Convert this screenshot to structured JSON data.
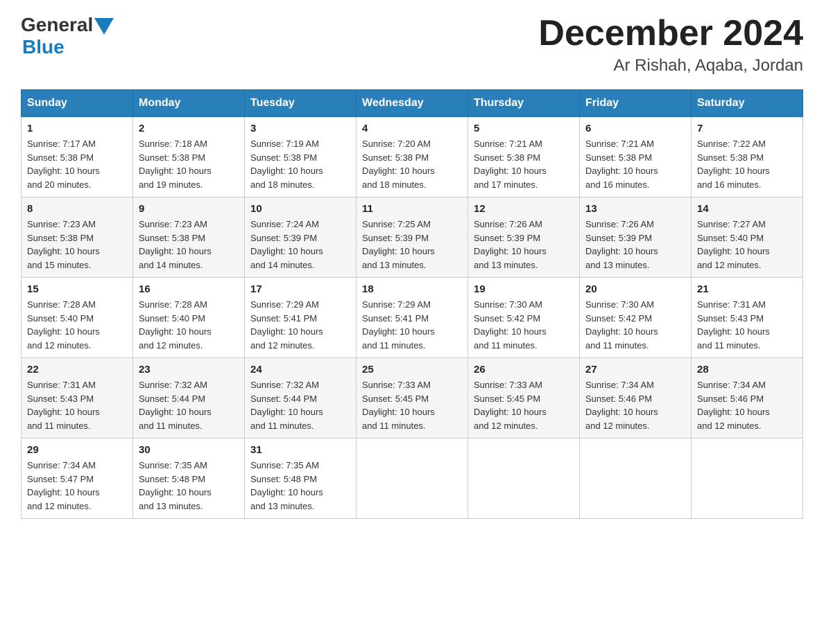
{
  "header": {
    "logo_general": "General",
    "logo_blue": "Blue",
    "month_title": "December 2024",
    "location": "Ar Rishah, Aqaba, Jordan"
  },
  "weekdays": [
    "Sunday",
    "Monday",
    "Tuesday",
    "Wednesday",
    "Thursday",
    "Friday",
    "Saturday"
  ],
  "weeks": [
    [
      {
        "day": "1",
        "sunrise": "7:17 AM",
        "sunset": "5:38 PM",
        "daylight": "10 hours and 20 minutes."
      },
      {
        "day": "2",
        "sunrise": "7:18 AM",
        "sunset": "5:38 PM",
        "daylight": "10 hours and 19 minutes."
      },
      {
        "day": "3",
        "sunrise": "7:19 AM",
        "sunset": "5:38 PM",
        "daylight": "10 hours and 18 minutes."
      },
      {
        "day": "4",
        "sunrise": "7:20 AM",
        "sunset": "5:38 PM",
        "daylight": "10 hours and 18 minutes."
      },
      {
        "day": "5",
        "sunrise": "7:21 AM",
        "sunset": "5:38 PM",
        "daylight": "10 hours and 17 minutes."
      },
      {
        "day": "6",
        "sunrise": "7:21 AM",
        "sunset": "5:38 PM",
        "daylight": "10 hours and 16 minutes."
      },
      {
        "day": "7",
        "sunrise": "7:22 AM",
        "sunset": "5:38 PM",
        "daylight": "10 hours and 16 minutes."
      }
    ],
    [
      {
        "day": "8",
        "sunrise": "7:23 AM",
        "sunset": "5:38 PM",
        "daylight": "10 hours and 15 minutes."
      },
      {
        "day": "9",
        "sunrise": "7:23 AM",
        "sunset": "5:38 PM",
        "daylight": "10 hours and 14 minutes."
      },
      {
        "day": "10",
        "sunrise": "7:24 AM",
        "sunset": "5:39 PM",
        "daylight": "10 hours and 14 minutes."
      },
      {
        "day": "11",
        "sunrise": "7:25 AM",
        "sunset": "5:39 PM",
        "daylight": "10 hours and 13 minutes."
      },
      {
        "day": "12",
        "sunrise": "7:26 AM",
        "sunset": "5:39 PM",
        "daylight": "10 hours and 13 minutes."
      },
      {
        "day": "13",
        "sunrise": "7:26 AM",
        "sunset": "5:39 PM",
        "daylight": "10 hours and 13 minutes."
      },
      {
        "day": "14",
        "sunrise": "7:27 AM",
        "sunset": "5:40 PM",
        "daylight": "10 hours and 12 minutes."
      }
    ],
    [
      {
        "day": "15",
        "sunrise": "7:28 AM",
        "sunset": "5:40 PM",
        "daylight": "10 hours and 12 minutes."
      },
      {
        "day": "16",
        "sunrise": "7:28 AM",
        "sunset": "5:40 PM",
        "daylight": "10 hours and 12 minutes."
      },
      {
        "day": "17",
        "sunrise": "7:29 AM",
        "sunset": "5:41 PM",
        "daylight": "10 hours and 12 minutes."
      },
      {
        "day": "18",
        "sunrise": "7:29 AM",
        "sunset": "5:41 PM",
        "daylight": "10 hours and 11 minutes."
      },
      {
        "day": "19",
        "sunrise": "7:30 AM",
        "sunset": "5:42 PM",
        "daylight": "10 hours and 11 minutes."
      },
      {
        "day": "20",
        "sunrise": "7:30 AM",
        "sunset": "5:42 PM",
        "daylight": "10 hours and 11 minutes."
      },
      {
        "day": "21",
        "sunrise": "7:31 AM",
        "sunset": "5:43 PM",
        "daylight": "10 hours and 11 minutes."
      }
    ],
    [
      {
        "day": "22",
        "sunrise": "7:31 AM",
        "sunset": "5:43 PM",
        "daylight": "10 hours and 11 minutes."
      },
      {
        "day": "23",
        "sunrise": "7:32 AM",
        "sunset": "5:44 PM",
        "daylight": "10 hours and 11 minutes."
      },
      {
        "day": "24",
        "sunrise": "7:32 AM",
        "sunset": "5:44 PM",
        "daylight": "10 hours and 11 minutes."
      },
      {
        "day": "25",
        "sunrise": "7:33 AM",
        "sunset": "5:45 PM",
        "daylight": "10 hours and 11 minutes."
      },
      {
        "day": "26",
        "sunrise": "7:33 AM",
        "sunset": "5:45 PM",
        "daylight": "10 hours and 12 minutes."
      },
      {
        "day": "27",
        "sunrise": "7:34 AM",
        "sunset": "5:46 PM",
        "daylight": "10 hours and 12 minutes."
      },
      {
        "day": "28",
        "sunrise": "7:34 AM",
        "sunset": "5:46 PM",
        "daylight": "10 hours and 12 minutes."
      }
    ],
    [
      {
        "day": "29",
        "sunrise": "7:34 AM",
        "sunset": "5:47 PM",
        "daylight": "10 hours and 12 minutes."
      },
      {
        "day": "30",
        "sunrise": "7:35 AM",
        "sunset": "5:48 PM",
        "daylight": "10 hours and 13 minutes."
      },
      {
        "day": "31",
        "sunrise": "7:35 AM",
        "sunset": "5:48 PM",
        "daylight": "10 hours and 13 minutes."
      },
      null,
      null,
      null,
      null
    ]
  ],
  "labels": {
    "sunrise": "Sunrise:",
    "sunset": "Sunset:",
    "daylight": "Daylight:"
  }
}
